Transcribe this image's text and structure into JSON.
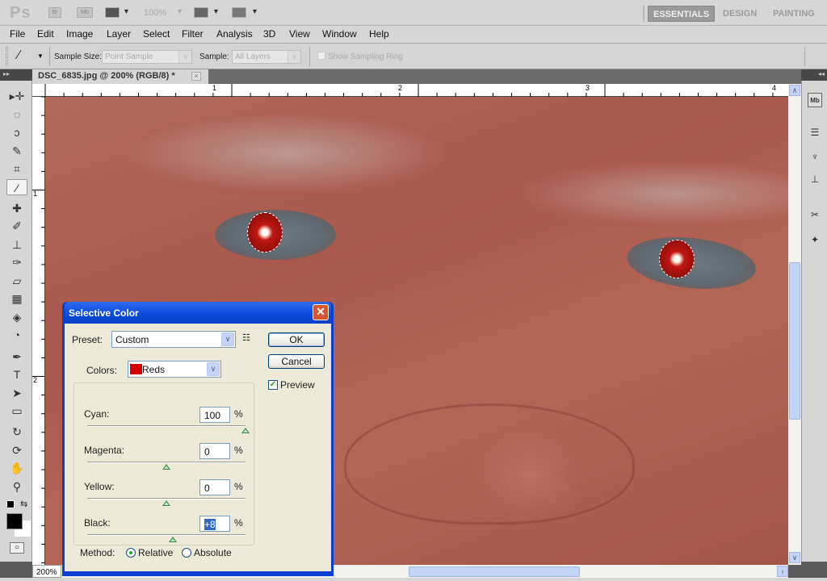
{
  "app": {
    "logo": "Ps",
    "bridge_label": "Br",
    "minibridge_label": "Mb",
    "zoom_display": "100%",
    "workspaces": [
      "ESSENTIALS",
      "DESIGN",
      "PAINTING"
    ],
    "active_workspace": "ESSENTIALS"
  },
  "menu": [
    "File",
    "Edit",
    "Image",
    "Layer",
    "Select",
    "Filter",
    "Analysis",
    "3D",
    "View",
    "Window",
    "Help"
  ],
  "options_bar": {
    "tool_icon": "eyedropper-icon",
    "sample_size_label": "Sample Size:",
    "sample_size_value": "Point Sample",
    "sample_label": "Sample:",
    "sample_value": "All Layers",
    "show_sampling_ring_label": "Show Sampling Ring",
    "show_sampling_ring_checked": false
  },
  "document": {
    "tab_title": "DSC_6835.jpg @ 200% (RGB/8) *",
    "zoom_field": "200%",
    "ruler_h_labels": [
      "1",
      "2",
      "3",
      "4"
    ],
    "ruler_v_labels": [
      "1",
      "2"
    ]
  },
  "tools": [
    {
      "name": "move-tool",
      "glyph": "▸✛"
    },
    {
      "name": "marquee-tool",
      "glyph": "◌"
    },
    {
      "name": "lasso-tool",
      "glyph": "ↄ"
    },
    {
      "name": "quick-selection-tool",
      "glyph": "✎"
    },
    {
      "name": "crop-tool",
      "glyph": "⌗"
    },
    {
      "name": "eyedropper-tool",
      "glyph": "⁄",
      "selected": true
    },
    {
      "name": "healing-brush-tool",
      "glyph": "✚"
    },
    {
      "name": "brush-tool",
      "glyph": "✐"
    },
    {
      "name": "clone-stamp-tool",
      "glyph": "⊥"
    },
    {
      "name": "history-brush-tool",
      "glyph": "✑"
    },
    {
      "name": "eraser-tool",
      "glyph": "▱"
    },
    {
      "name": "gradient-tool",
      "glyph": "▦"
    },
    {
      "name": "blur-tool",
      "glyph": "◈"
    },
    {
      "name": "dodge-tool",
      "glyph": "◔"
    },
    {
      "name": "pen-tool",
      "glyph": "✒"
    },
    {
      "name": "type-tool",
      "glyph": "T"
    },
    {
      "name": "path-selection-tool",
      "glyph": "➤"
    },
    {
      "name": "shape-tool",
      "glyph": "▭"
    },
    {
      "name": "3d-rotate-tool",
      "glyph": "↻"
    },
    {
      "name": "3d-orbit-tool",
      "glyph": "⟳"
    },
    {
      "name": "hand-tool",
      "glyph": "✋"
    },
    {
      "name": "zoom-tool",
      "glyph": "⚲"
    }
  ],
  "colors": {
    "foreground": "#000000",
    "background": "#ffffff"
  },
  "right_panel": [
    "mini-bridge-icon",
    "adjustments-icon",
    "brush-presets-icon",
    "clone-source-icon",
    "tool-presets-icon",
    "3d-icon"
  ],
  "dialog": {
    "title": "Selective Color",
    "preset_label": "Preset:",
    "preset_value": "Custom",
    "ok_label": "OK",
    "cancel_label": "Cancel",
    "preview_label": "Preview",
    "preview_checked": true,
    "colors_label": "Colors:",
    "colors_value": "Reds",
    "colors_swatch": "#d40000",
    "sliders": [
      {
        "label": "Cyan:",
        "value": "100",
        "percent": 100
      },
      {
        "label": "Magenta:",
        "value": "0",
        "percent": 0
      },
      {
        "label": "Yellow:",
        "value": "0",
        "percent": 0
      },
      {
        "label": "Black:",
        "value": "+8",
        "percent": 8
      }
    ],
    "unit": "%",
    "method_label": "Method:",
    "methods": [
      "Relative",
      "Absolute"
    ],
    "selected_method": "Relative"
  }
}
